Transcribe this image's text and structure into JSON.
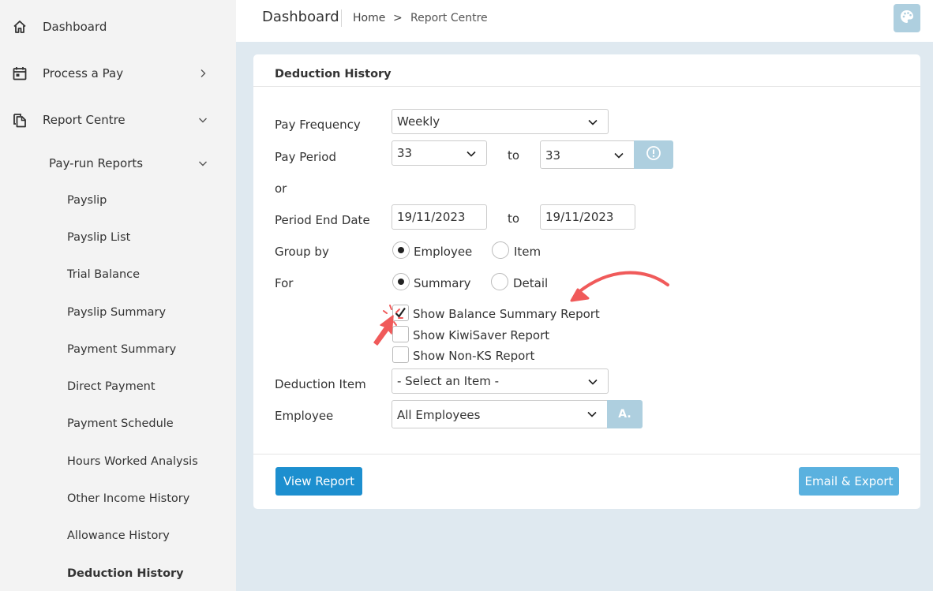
{
  "sidebar": {
    "items": [
      {
        "label": "Dashboard",
        "icon": "home-icon"
      },
      {
        "label": "Process a Pay",
        "icon": "calendar-icon"
      },
      {
        "label": "Report Centre",
        "icon": "documents-icon"
      }
    ],
    "group": {
      "label": "Pay-run Reports"
    },
    "sub_items": [
      {
        "label": "Payslip"
      },
      {
        "label": "Payslip List"
      },
      {
        "label": "Trial Balance"
      },
      {
        "label": "Payslip Summary"
      },
      {
        "label": "Payment Summary"
      },
      {
        "label": "Direct Payment"
      },
      {
        "label": "Payment Schedule"
      },
      {
        "label": "Hours Worked Analysis"
      },
      {
        "label": "Other Income History"
      },
      {
        "label": "Allowance History"
      },
      {
        "label": "Deduction History"
      }
    ],
    "active": "Deduction History"
  },
  "topbar": {
    "title": "Dashboard",
    "breadcrumb": {
      "home": "Home",
      "separator": ">",
      "current": "Report Centre"
    }
  },
  "card": {
    "title": "Deduction History",
    "form": {
      "pay_frequency": {
        "label": "Pay Frequency",
        "value": "Weekly"
      },
      "pay_period": {
        "label": "Pay Period",
        "from": "33",
        "to_label": "to",
        "to": "33"
      },
      "or_label": "or",
      "period_end_date": {
        "label": "Period End Date",
        "from": "19/11/2023",
        "to_label": "to",
        "to": "19/11/2023"
      },
      "group_by": {
        "label": "Group by",
        "options": [
          "Employee",
          "Item"
        ],
        "selected": "Employee"
      },
      "for": {
        "label": "For",
        "options": [
          "Summary",
          "Detail"
        ],
        "selected": "Summary"
      },
      "checkboxes": [
        {
          "label": "Show Balance Summary Report",
          "checked": true
        },
        {
          "label": "Show KiwiSaver Report",
          "checked": false
        },
        {
          "label": "Show Non-KS Report",
          "checked": false
        }
      ],
      "deduction_item": {
        "label": "Deduction Item",
        "value": "- Select an Item -"
      },
      "employee": {
        "label": "Employee",
        "value": "All Employees",
        "addon": "A."
      }
    },
    "buttons": {
      "view": "View Report",
      "email": "Email & Export"
    }
  },
  "colors": {
    "sidebar_bg": "#f3f3f3",
    "page_bg": "#dfe9f0",
    "primary": "#1d8fcf",
    "secondary": "#5ab1df",
    "addon": "#aecfdf",
    "annotation": "#f05a5a"
  }
}
